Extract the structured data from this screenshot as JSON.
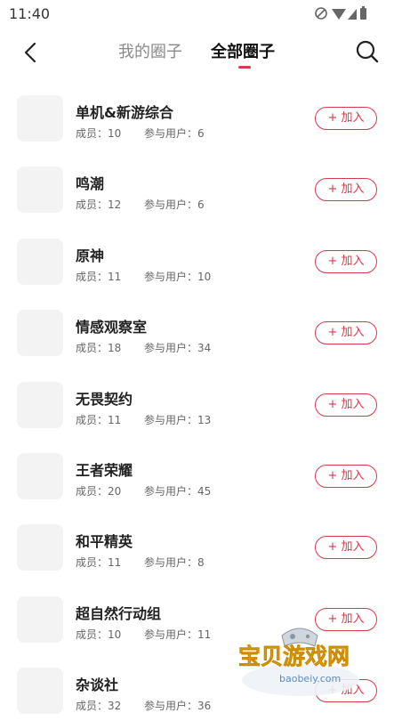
{
  "status_bar": {
    "time": "11:40"
  },
  "header": {
    "tabs": [
      {
        "label": "我的圈子",
        "active": false
      },
      {
        "label": "全部圈子",
        "active": true
      }
    ]
  },
  "colors": {
    "accent": "#d83a4a"
  },
  "circles": [
    {
      "name": "单机&新游综合",
      "members": "成员：10",
      "users": "参与用户：6",
      "join_label": "+ 加入"
    },
    {
      "name": "鸣潮",
      "members": "成员：12",
      "users": "参与用户：6",
      "join_label": "+ 加入"
    },
    {
      "name": "原神",
      "members": "成员：11",
      "users": "参与用户：10",
      "join_label": "+ 加入"
    },
    {
      "name": "情感观察室",
      "members": "成员：18",
      "users": "参与用户：34",
      "join_label": "+ 加入"
    },
    {
      "name": "无畏契约",
      "members": "成员：11",
      "users": "参与用户：13",
      "join_label": "+ 加入"
    },
    {
      "name": "王者荣耀",
      "members": "成员：20",
      "users": "参与用户：45",
      "join_label": "+ 加入"
    },
    {
      "name": "和平精英",
      "members": "成员：11",
      "users": "参与用户：8",
      "join_label": "+ 加入"
    },
    {
      "name": "超自然行动组",
      "members": "成员：10",
      "users": "参与用户：11",
      "join_label": "+ 加入"
    },
    {
      "name": "杂谈社",
      "members": "成员：32",
      "users": "参与用户：36",
      "join_label": "+ 加入"
    }
  ],
  "watermark": {
    "text": "宝贝游戏网",
    "url": "baobeiy.com"
  }
}
